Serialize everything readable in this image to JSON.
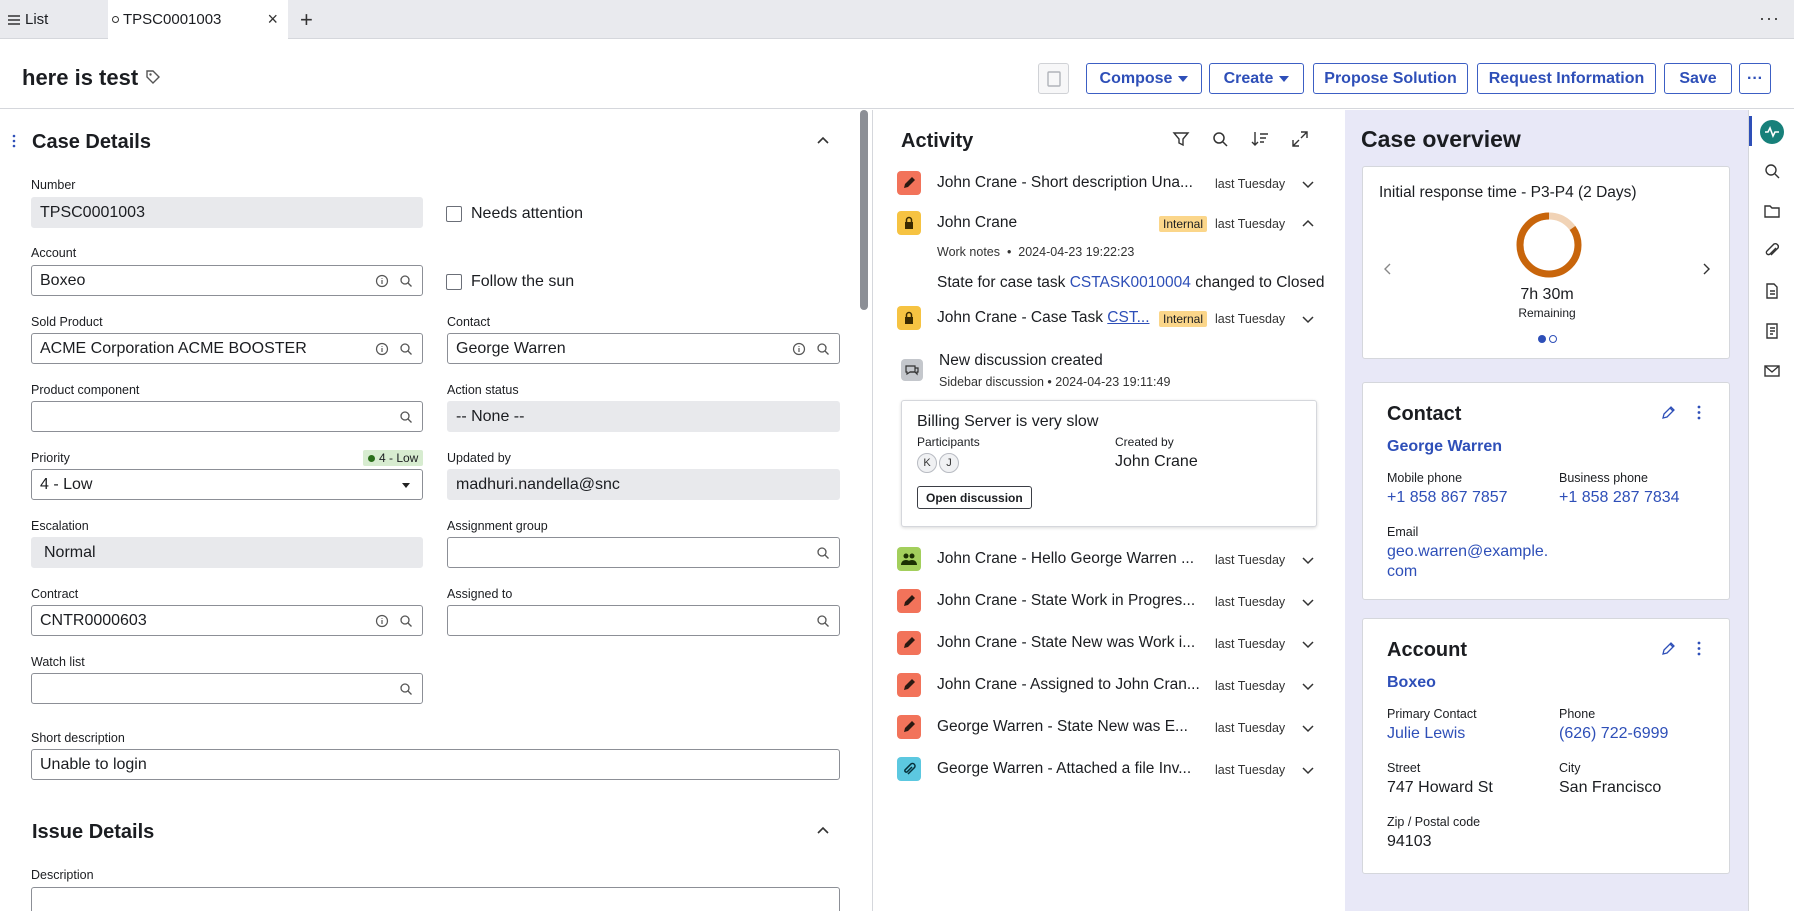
{
  "tabs": {
    "list_label": "List",
    "active_label": "TPSC0001003"
  },
  "header": {
    "title": "here is test",
    "compose": "Compose",
    "create": "Create",
    "propose": "Propose Solution",
    "request": "Request Information",
    "save": "Save"
  },
  "case_details": {
    "title": "Case Details",
    "number_label": "Number",
    "number": "TPSC0001003",
    "needs_attention": "Needs attention",
    "account_label": "Account",
    "account": "Boxeo",
    "follow_sun": "Follow the sun",
    "sold_product_label": "Sold Product",
    "sold_product": "ACME Corporation ACME BOOSTER",
    "contact_label": "Contact",
    "contact": "George Warren",
    "product_component_label": "Product component",
    "product_component": "",
    "action_status_label": "Action status",
    "action_status": "-- None --",
    "priority_label": "Priority",
    "priority_badge": "4 - Low",
    "priority": "4 - Low",
    "updated_by_label": "Updated by",
    "updated_by": "madhuri.nandella@snc",
    "escalation_label": "Escalation",
    "escalation": "Normal",
    "assignment_group_label": "Assignment group",
    "assignment_group": "",
    "contract_label": "Contract",
    "contract": "CNTR0000603",
    "assigned_to_label": "Assigned to",
    "assigned_to": "",
    "watch_list_label": "Watch list",
    "watch_list": "",
    "short_desc_label": "Short description",
    "short_desc": "Unable to login"
  },
  "issue_details": {
    "title": "Issue Details",
    "description_label": "Description"
  },
  "activity": {
    "title": "Activity",
    "items": [
      {
        "text": "John Crane - Short description Una...",
        "time": "last Tuesday",
        "icon": "pencil-icon",
        "color": "#f2735a"
      },
      {
        "text": "John Crane",
        "time": "last Tuesday",
        "icon": "lock-icon",
        "color": "#f6c342",
        "badge": "Internal"
      },
      {
        "text": "John Crane - Case Task ",
        "link": "CST...",
        "time": "last Tuesday",
        "icon": "lock-icon",
        "color": "#f6c342",
        "badge": "Internal"
      },
      {
        "text": "John Crane - Hello George Warren ...",
        "time": "last Tuesday",
        "icon": "people-icon",
        "color": "#a3cf5c"
      },
      {
        "text": "John Crane - State Work in Progres...",
        "time": "last Tuesday",
        "icon": "pencil-icon",
        "color": "#f2735a"
      },
      {
        "text": "John Crane - State New was Work i...",
        "time": "last Tuesday",
        "icon": "pencil-icon",
        "color": "#f2735a"
      },
      {
        "text": "John Crane - Assigned to John Cran...",
        "time": "last Tuesday",
        "icon": "pencil-icon",
        "color": "#f2735a"
      },
      {
        "text": "George Warren - State New was E...",
        "time": "last Tuesday",
        "icon": "pencil-icon",
        "color": "#f2735a"
      },
      {
        "text": "George Warren - Attached a file Inv...",
        "time": "last Tuesday",
        "icon": "paperclip-icon",
        "color": "#5cc8e0"
      }
    ],
    "work_notes": "Work notes",
    "work_notes_time": "2024-04-23 19:22:23",
    "state_text": "State for case task ",
    "state_link": "CSTASK0010004",
    "state_suffix": " changed to Closed",
    "discussion_title": "New discussion created",
    "discussion_meta": "Sidebar discussion",
    "discussion_time": "2024-04-23 19:11:49",
    "card_title": "Billing Server is very slow",
    "participants_label": "Participants",
    "created_by_label": "Created by",
    "created_by": "John Crane",
    "avatars": [
      "K",
      "J"
    ],
    "open_discussion": "Open discussion"
  },
  "overview": {
    "title": "Case overview",
    "sla_title": "Initial response time - P3-P4 (2 Days)",
    "sla_value": "7h 30m",
    "sla_sub": "Remaining",
    "sla_elapsed_fraction": 0.15,
    "contact": {
      "title": "Contact",
      "name": "George Warren",
      "mobile_label": "Mobile phone",
      "mobile": "+1 858 867 7857",
      "business_label": "Business phone",
      "business": "+1 858 287 7834",
      "email_label": "Email",
      "email_1": "geo.warren@example.",
      "email_2": "com"
    },
    "account": {
      "title": "Account",
      "name": "Boxeo",
      "primary_label": "Primary Contact",
      "primary": "Julie Lewis",
      "phone_label": "Phone",
      "phone": "(626) 722-6999",
      "street_label": "Street",
      "street": "747 Howard St",
      "city_label": "City",
      "city": "San Francisco",
      "zip_label": "Zip / Postal code",
      "zip": "94103"
    }
  },
  "colors": {
    "accent": "#2e4fb8",
    "sla_ring": "#c8650b",
    "overview_bg": "#e8e8f7"
  }
}
